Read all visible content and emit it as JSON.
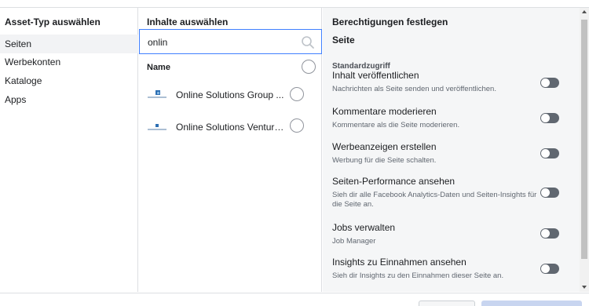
{
  "asset_types": {
    "header": "Asset-Typ auswählen",
    "items": [
      {
        "label": "Seiten"
      },
      {
        "label": "Werbekonten"
      },
      {
        "label": "Kataloge"
      },
      {
        "label": "Apps"
      }
    ]
  },
  "content": {
    "header": "Inhalte auswählen",
    "search": {
      "value": "onlin",
      "icon": "search-icon"
    },
    "name_header": "Name",
    "pages": [
      {
        "name": "Online Solutions Group ..."
      },
      {
        "name": "Online Solutions Venture..."
      }
    ]
  },
  "permissions": {
    "header": "Berechtigungen festlegen",
    "section_title": "Seite",
    "subsection": "Standardzugriff",
    "items": [
      {
        "name": "Inhalt veröffentlichen",
        "desc": "Nachrichten als Seite senden und veröffentlichen.",
        "enabled": false
      },
      {
        "name": "Kommentare moderieren",
        "desc": "Kommentare als die Seite moderieren.",
        "enabled": false
      },
      {
        "name": "Werbeanzeigen erstellen",
        "desc": "Werbung für die Seite schalten.",
        "enabled": false
      },
      {
        "name": "Seiten-Performance ansehen",
        "desc": "Sieh dir alle Facebook Analytics-Daten und Seiten-Insights für die Seite an.",
        "enabled": false
      },
      {
        "name": "Jobs verwalten",
        "desc": "Job Manager",
        "enabled": false
      },
      {
        "name": "Insights zu Einnahmen ansehen",
        "desc": "Sieh dir Insights zu den Einnahmen dieser Seite an.",
        "enabled": false
      }
    ]
  },
  "colors": {
    "focus_border": "#4080ff",
    "toggle_off": "#606770",
    "panel_bg": "#f5f6f7",
    "selected_bg": "#f2f3f5"
  }
}
